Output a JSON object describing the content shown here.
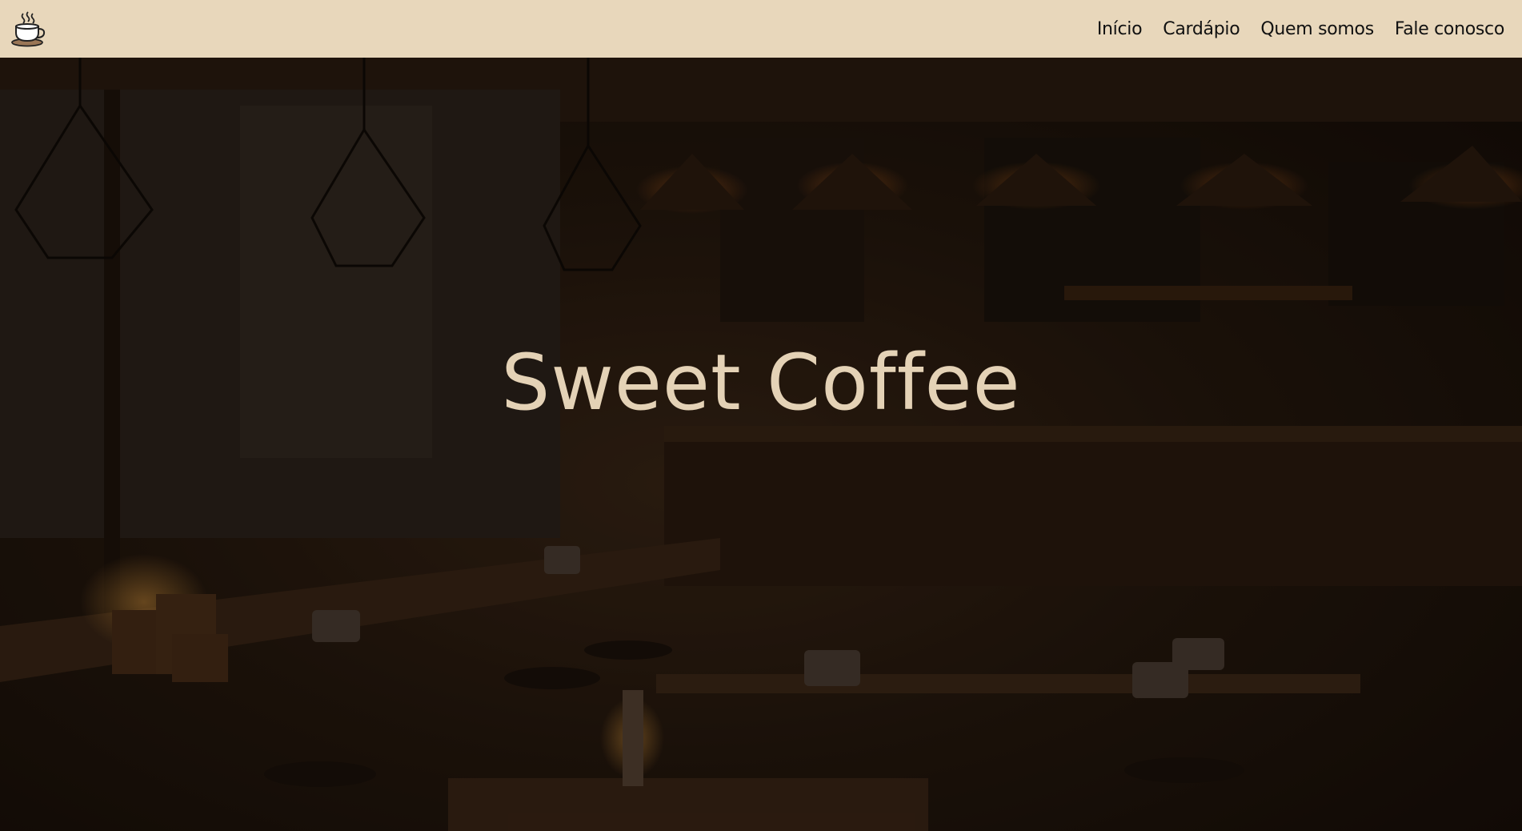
{
  "header": {
    "logo_icon": "coffee-cup-icon",
    "nav": [
      {
        "label": "Início"
      },
      {
        "label": "Cardápio"
      },
      {
        "label": "Quem somos"
      },
      {
        "label": "Fale conosco"
      }
    ]
  },
  "hero": {
    "title": "Sweet Coffee",
    "background": "dark coffee shop interior image"
  },
  "colors": {
    "navbar_bg": "#e8d7bb",
    "hero_title": "#e4d2b6",
    "hero_dark": "#140d08"
  }
}
